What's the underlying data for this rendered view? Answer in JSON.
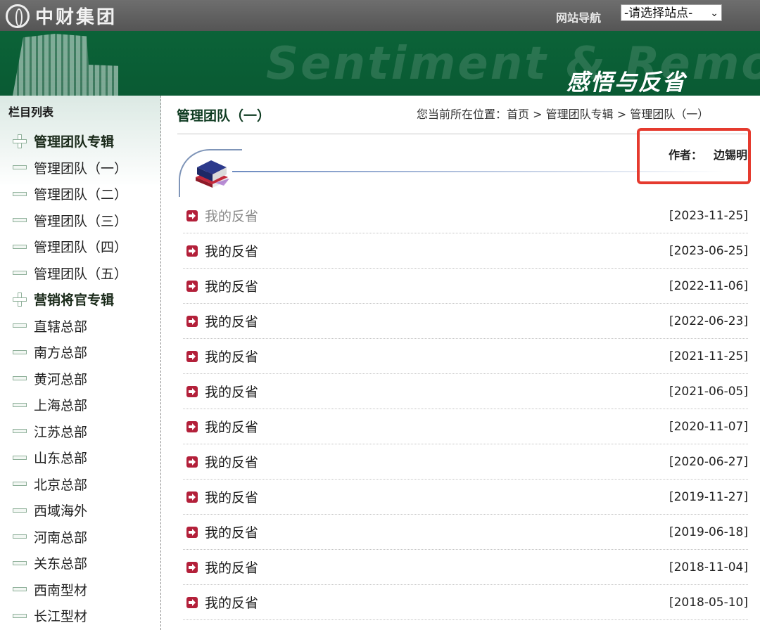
{
  "header": {
    "logo_text": "中财集团",
    "site_nav_label": "网站导航",
    "site_select_value": "-请选择站点-"
  },
  "banner": {
    "english": "Sentiment & Remorse",
    "chinese": "感悟与反省"
  },
  "sidebar": {
    "title": "栏目列表",
    "items": [
      {
        "label": "管理团队专辑",
        "type": "group"
      },
      {
        "label": "管理团队（一）",
        "type": "item"
      },
      {
        "label": "管理团队（二）",
        "type": "item"
      },
      {
        "label": "管理团队（三）",
        "type": "item"
      },
      {
        "label": "管理团队（四）",
        "type": "item"
      },
      {
        "label": "管理团队（五）",
        "type": "item"
      },
      {
        "label": "营销将官专辑",
        "type": "group"
      },
      {
        "label": "直辖总部",
        "type": "item"
      },
      {
        "label": "南方总部",
        "type": "item"
      },
      {
        "label": "黄河总部",
        "type": "item"
      },
      {
        "label": "上海总部",
        "type": "item"
      },
      {
        "label": "江苏总部",
        "type": "item"
      },
      {
        "label": "山东总部",
        "type": "item"
      },
      {
        "label": "北京总部",
        "type": "item"
      },
      {
        "label": "西域海外",
        "type": "item"
      },
      {
        "label": "河南总部",
        "type": "item"
      },
      {
        "label": "关东总部",
        "type": "item"
      },
      {
        "label": "西南型材",
        "type": "item"
      },
      {
        "label": "长江型材",
        "type": "item"
      }
    ]
  },
  "main": {
    "title": "管理团队（一）",
    "breadcrumb": {
      "prefix": "您当前所在位置：",
      "home": "首页",
      "sep": " > ",
      "level1": "管理团队专辑",
      "level2": "管理团队（一）"
    },
    "author_label": "作者：",
    "author_name": "边锡明",
    "articles": [
      {
        "title": "我的反省",
        "date": "[2023-11-25]",
        "visited": true
      },
      {
        "title": "我的反省",
        "date": "[2023-06-25]",
        "visited": false
      },
      {
        "title": "我的反省",
        "date": "[2022-11-06]",
        "visited": false
      },
      {
        "title": "我的反省",
        "date": "[2022-06-23]",
        "visited": false
      },
      {
        "title": "我的反省",
        "date": "[2021-11-25]",
        "visited": false
      },
      {
        "title": "我的反省",
        "date": "[2021-06-05]",
        "visited": false
      },
      {
        "title": "我的反省",
        "date": "[2020-11-07]",
        "visited": false
      },
      {
        "title": "我的反省",
        "date": "[2020-06-27]",
        "visited": false
      },
      {
        "title": "我的反省",
        "date": "[2019-11-27]",
        "visited": false
      },
      {
        "title": "我的反省",
        "date": "[2019-06-18]",
        "visited": false
      },
      {
        "title": "我的反省",
        "date": "[2018-11-04]",
        "visited": false
      },
      {
        "title": "我的反省",
        "date": "[2018-05-10]",
        "visited": false
      }
    ]
  },
  "colors": {
    "banner_green": "#0b6338",
    "topbar_gray": "#5e5e5e",
    "highlight_red": "#e53a2e",
    "arrow_red": "#b3203a"
  }
}
